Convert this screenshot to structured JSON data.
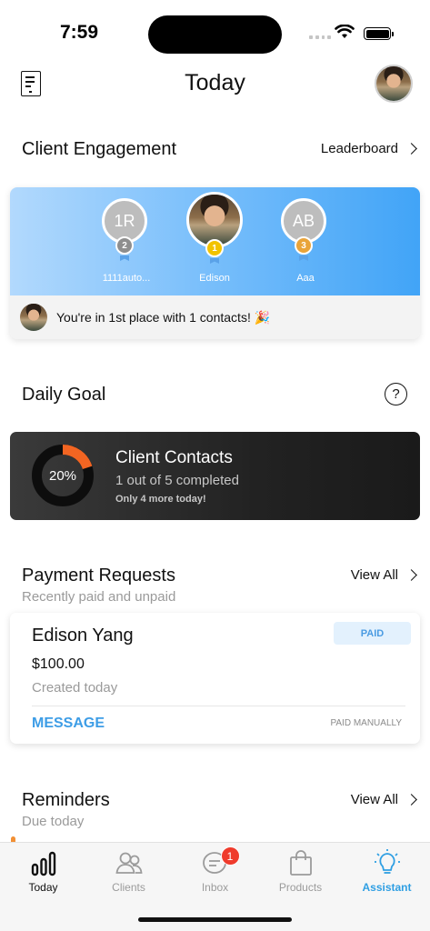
{
  "status_bar": {
    "time": "7:59"
  },
  "header": {
    "title": "Today",
    "doc_icon": "document-icon",
    "avatar": "profile-avatar"
  },
  "engagement": {
    "title": "Client Engagement",
    "link_label": "Leaderboard",
    "podium": [
      {
        "rank": "2",
        "initials": "1R",
        "name": "1111auto...",
        "medal_color": "#8e8e8e"
      },
      {
        "rank": "1",
        "initials": "",
        "name": "Edison",
        "medal_color": "#f2c300"
      },
      {
        "rank": "3",
        "initials": "AB",
        "name": "Aaa",
        "medal_color": "#e9a43a"
      }
    ],
    "message": "You're in 1st place with 1 contacts! 🎉"
  },
  "daily_goal": {
    "title": "Daily Goal",
    "help_symbol": "?",
    "percent_label": "20%",
    "progress_fraction": 0.2,
    "card_title": "Client Contacts",
    "progress_text": "1 out of 5 completed",
    "note": "Only 4 more today!",
    "accent_color": "#f26522"
  },
  "payments": {
    "title": "Payment Requests",
    "subtitle": "Recently paid and unpaid",
    "link_label": "View All",
    "card": {
      "name": "Edison Yang",
      "status": "PAID",
      "amount": "$100.00",
      "created": "Created today",
      "action": "MESSAGE",
      "method": "PAID MANUALLY"
    }
  },
  "reminders": {
    "title": "Reminders",
    "subtitle": "Due today",
    "link_label": "View All"
  },
  "tab_bar": {
    "tabs": [
      {
        "label": "Today",
        "icon": "bar-chart-icon"
      },
      {
        "label": "Clients",
        "icon": "people-icon"
      },
      {
        "label": "Inbox",
        "icon": "chat-icon",
        "badge": "1"
      },
      {
        "label": "Products",
        "icon": "shopping-bag-icon"
      },
      {
        "label": "Assistant",
        "icon": "lightbulb-icon"
      }
    ]
  },
  "colors": {
    "accent_blue": "#2f9fe3",
    "badge_red": "#ef3b2c",
    "goal_orange": "#f26522"
  }
}
